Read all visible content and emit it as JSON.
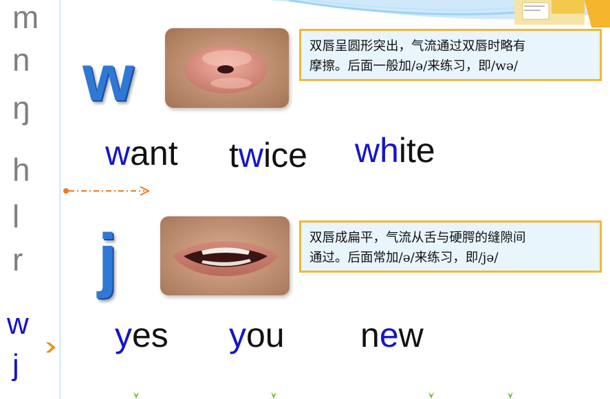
{
  "sidebar": {
    "phonemes": [
      {
        "label": "m"
      },
      {
        "label": "n"
      },
      {
        "label": "ŋ"
      },
      {
        "label": "h"
      },
      {
        "label": "l"
      },
      {
        "label": "r"
      },
      {
        "label": "w"
      },
      {
        "label": "j"
      }
    ],
    "active": [
      "w",
      "j"
    ]
  },
  "section_w": {
    "letter": "w",
    "description_line1": "双唇呈圆形突出，气流通过双唇时略有",
    "description_line2": "摩擦。后面一般加/ə/来练习，即/wə/",
    "words": [
      {
        "hl": "w",
        "rest": "ant"
      },
      {
        "pre": "t",
        "hl": "w",
        "rest": "ice"
      },
      {
        "hl": "wh",
        "rest": "ite"
      }
    ]
  },
  "section_j": {
    "letter": "j",
    "description_line1": "双唇成扁平，气流从舌与硬腭的缝隙间",
    "description_line2": "通过。后面常加/ə/来练习，即/jə/",
    "words": [
      {
        "hl": "y",
        "rest": "es"
      },
      {
        "hl": "y",
        "rest": "ou"
      },
      {
        "pre": "n",
        "hl": "e",
        "rest": "w"
      }
    ]
  },
  "colors": {
    "highlight": "#1515c8",
    "big_letter": "#2f78d6",
    "box_border": "#f3b733",
    "box_fill": "#e9f5fd",
    "inactive_phoneme": "#7f7f7f",
    "arrow": "#f07a1a"
  },
  "icons": [
    "next-chevron-icon",
    "dash-dot-arrow-icon"
  ]
}
